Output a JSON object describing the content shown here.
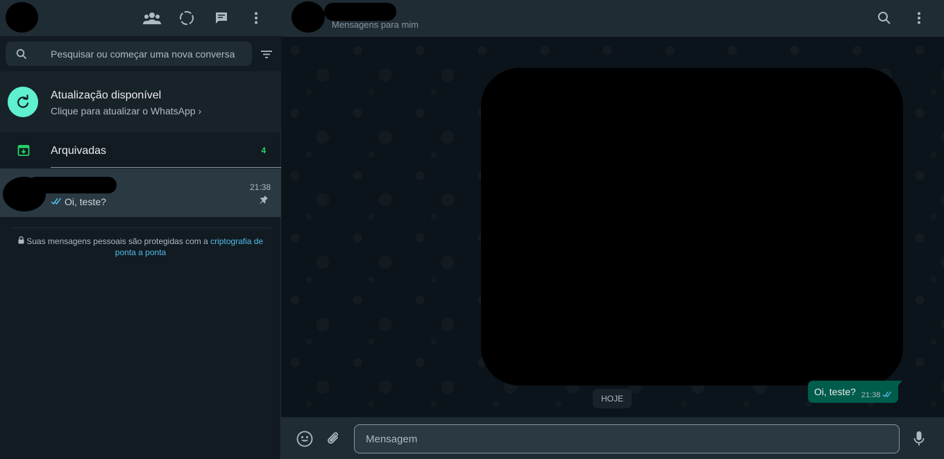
{
  "left_header": {
    "icons": [
      "communities-icon",
      "status-icon",
      "new-chat-icon",
      "menu-icon"
    ]
  },
  "search": {
    "placeholder": "Pesquisar ou começar uma nova conversa"
  },
  "update_banner": {
    "title": "Atualização disponível",
    "subtitle": "Clique para atualizar o WhatsApp",
    "chevron": "›"
  },
  "archived": {
    "label": "Arquivadas",
    "count": "4"
  },
  "chat_list": [
    {
      "time": "21:38",
      "last_message": "Oi, teste?",
      "pinned": true
    }
  ],
  "encryption_note": {
    "text": "Suas mensagens pessoais são protegidas com a",
    "link": "criptografia de ponta a ponta"
  },
  "conversation": {
    "status": "Mensagens para mim",
    "day_label": "HOJE",
    "messages": [
      {
        "text": "Oi, teste?",
        "time": "21:38",
        "outgoing": true,
        "read": true
      }
    ]
  },
  "composer": {
    "placeholder": "Mensagem"
  },
  "colors": {
    "accent": "#00a884",
    "read_ticks": "#53bdeb",
    "bubble_out": "#005c4b",
    "panel": "#202c33",
    "background": "#111b21"
  }
}
